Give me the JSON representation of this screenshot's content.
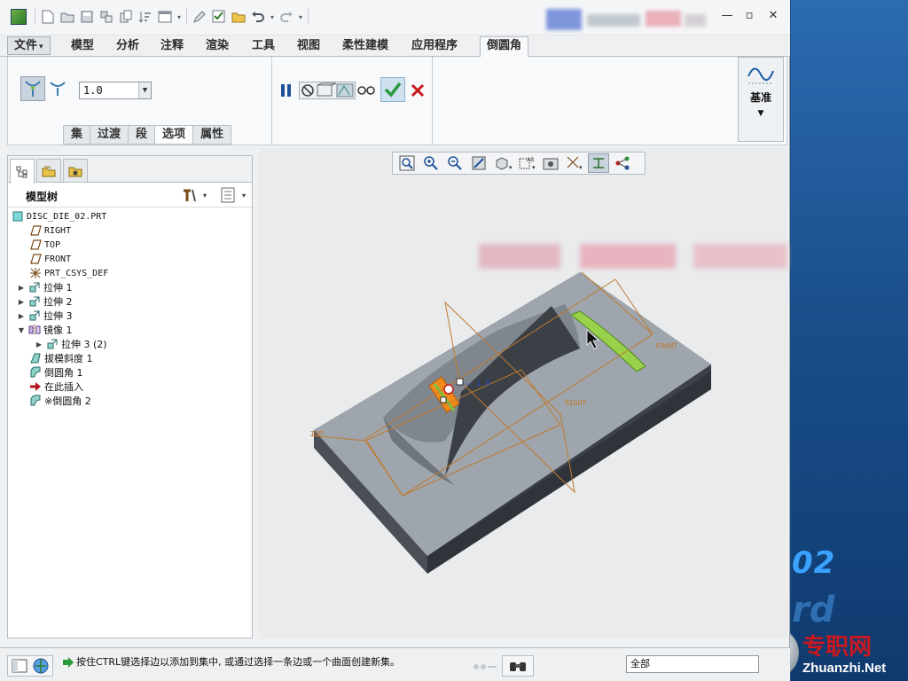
{
  "quick_access": {
    "icons": [
      "new-icon",
      "open-icon",
      "save-icon",
      "regenerate-icon",
      "copy-icon",
      "sort-icon",
      "window-icon",
      "dropdown-icon",
      "edit-icon",
      "checklist-icon",
      "folder-icon",
      "undo-icon",
      "dropdown-icon",
      "redo-icon",
      "dropdown-icon"
    ]
  },
  "ribbon": {
    "tabs": [
      {
        "label": "文件",
        "dropdown": "▾"
      },
      {
        "label": "模型"
      },
      {
        "label": "分析"
      },
      {
        "label": "注释"
      },
      {
        "label": "渲染"
      },
      {
        "label": "工具"
      },
      {
        "label": "视图"
      },
      {
        "label": "柔性建模"
      },
      {
        "label": "应用程序"
      },
      {
        "label": "倒圆角"
      }
    ],
    "active_tab": "倒圆角",
    "radius_value": "1.0",
    "sub_tabs": [
      "集",
      "过渡",
      "段",
      "选项",
      "属性"
    ],
    "active_sub_tab": "选项",
    "datum_label": "基准"
  },
  "model_tree": {
    "title": "模型树",
    "nodes": [
      {
        "label": "DISC_DIE_02.PRT",
        "icon": "part-icon",
        "expand": ""
      },
      {
        "label": "RIGHT",
        "icon": "datum-plane-icon",
        "expand": ""
      },
      {
        "label": "TOP",
        "icon": "datum-plane-icon",
        "expand": ""
      },
      {
        "label": "FRONT",
        "icon": "datum-plane-icon",
        "expand": ""
      },
      {
        "label": "PRT_CSYS_DEF",
        "icon": "csys-icon",
        "expand": ""
      },
      {
        "label": "拉伸 1",
        "icon": "extrude-icon",
        "expand": "▶"
      },
      {
        "label": "拉伸 2",
        "icon": "extrude-icon",
        "expand": "▶"
      },
      {
        "label": "拉伸 3",
        "icon": "extrude-icon",
        "expand": "▶"
      },
      {
        "label": "镜像 1",
        "icon": "mirror-icon",
        "expand": "▼"
      },
      {
        "label": "拉伸 3 (2)",
        "icon": "extrude-icon",
        "expand": "▶"
      },
      {
        "label": "拔模斜度 1",
        "icon": "draft-icon",
        "expand": ""
      },
      {
        "label": "倒圆角 1",
        "icon": "round-icon",
        "expand": ""
      },
      {
        "label": "在此插入",
        "icon": "insert-here-icon",
        "expand": ""
      },
      {
        "label": "※倒圆角 2",
        "icon": "round-icon",
        "expand": ""
      }
    ]
  },
  "scene": {
    "plane_labels": {
      "front": "FRONT",
      "right": "RIGHT",
      "top": "TOP"
    },
    "dimension": "1.0"
  },
  "status": {
    "message": "按住CTRL键选择边以添加到集中, 或通过选择一条边或一个曲面创建新集。",
    "filter": "全部"
  },
  "watermark": {
    "cn": "专职网",
    "en": "Zhuanzhi.Net"
  },
  "desktop_text": "02",
  "colors": {
    "accent_green": "#2b9a3c",
    "cancel_red": "#c8171c",
    "datum_orange": "#c07a2e",
    "selection_green": "#9ad14b"
  }
}
